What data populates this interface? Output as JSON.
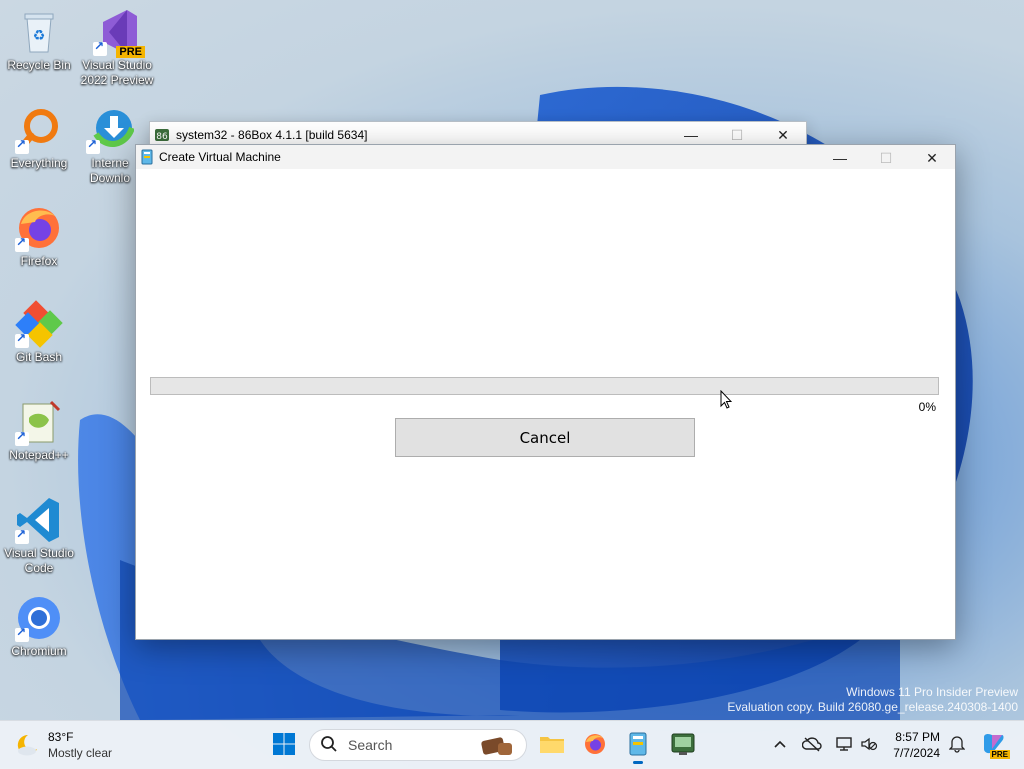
{
  "desktop": {
    "icons": [
      {
        "label": "Recycle Bin"
      },
      {
        "label": "Visual Studio 2022 Preview",
        "badge": "PRE"
      },
      {
        "label": "Everything"
      },
      {
        "label": "Internet Download Manager",
        "visible_label": "Interne\nDownlo"
      },
      {
        "label": "Firefox"
      },
      {
        "label": "Git Bash"
      },
      {
        "label": "Notepad++"
      },
      {
        "label": "Visual Studio Code"
      },
      {
        "label": "Chromium"
      }
    ],
    "watermark_line1": "Windows 11 Pro Insider Preview",
    "watermark_line2": "Evaluation copy. Build 26080.ge_release.240308-1400"
  },
  "back_window": {
    "title": "system32 - 86Box 4.1.1 [build 5634]",
    "minimize": "—",
    "maximize": "☐",
    "close": "✕"
  },
  "dialog": {
    "title": "Create Virtual Machine",
    "progress": {
      "value": 0,
      "label": "0%",
      "color": "#06b025"
    },
    "cancel_label": "Cancel",
    "minimize": "—",
    "maximize": "☐",
    "close": "✕"
  },
  "taskbar": {
    "weather": {
      "temp": "83°F",
      "condition": "Mostly clear"
    },
    "search_placeholder": "Search",
    "apps": [
      "start-icon",
      "search",
      "widgets-icon",
      "file-explorer-icon",
      "firefox-icon",
      "86box-dialog-icon",
      "86box-icon"
    ],
    "clock_time": "8:57 PM",
    "clock_date": "7/7/2024",
    "copilot_badge": "PRE"
  },
  "colors": {
    "accent": "#0067c0",
    "progress": "#06b025"
  }
}
